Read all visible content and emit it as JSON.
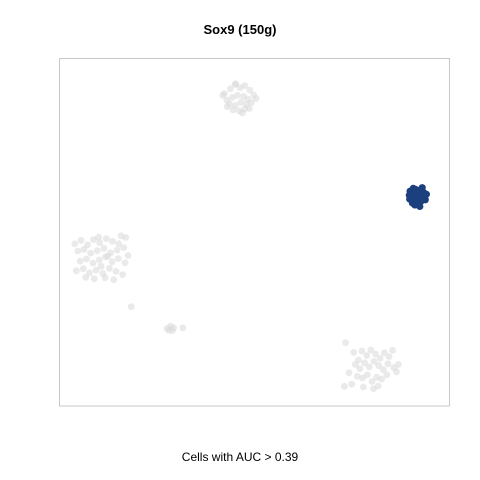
{
  "chart_data": {
    "type": "scatter",
    "title": "Sox9 (150g)",
    "caption": "Cells with AUC > 0.39",
    "xlim": [
      0,
      100
    ],
    "ylim": [
      0,
      100
    ],
    "grid": false,
    "colors": {
      "active": "#1c3f7e",
      "inactive": "#d9d9d9",
      "frame": "#c8c8c8"
    },
    "series": [
      {
        "status": "active",
        "points": [
          [
            90.0,
            61.8
          ],
          [
            91.4,
            62.3
          ],
          [
            92.6,
            62.1
          ],
          [
            93.5,
            61.4
          ],
          [
            89.8,
            60.6
          ],
          [
            91.0,
            60.8
          ],
          [
            92.3,
            60.4
          ],
          [
            93.7,
            60.1
          ],
          [
            90.4,
            59.3
          ],
          [
            91.6,
            59.0
          ],
          [
            92.8,
            58.9
          ],
          [
            93.9,
            59.3
          ],
          [
            91.2,
            57.8
          ],
          [
            92.5,
            57.4
          ],
          [
            90.6,
            58.4
          ],
          [
            92.0,
            61.3
          ],
          [
            90.8,
            62.6
          ],
          [
            93.1,
            62.8
          ],
          [
            94.2,
            60.9
          ],
          [
            89.9,
            59.5
          ]
        ]
      },
      {
        "status": "inactive",
        "points": [
          [
            42.3,
            90.0
          ],
          [
            43.8,
            91.4
          ],
          [
            45.0,
            92.6
          ],
          [
            46.3,
            91.7
          ],
          [
            47.5,
            92.3
          ],
          [
            48.8,
            91.0
          ],
          [
            49.8,
            89.6
          ],
          [
            42.9,
            88.1
          ],
          [
            44.3,
            88.9
          ],
          [
            45.6,
            89.5
          ],
          [
            47.2,
            89.2
          ],
          [
            48.3,
            88.4
          ],
          [
            43.6,
            87.0
          ],
          [
            45.1,
            86.6
          ],
          [
            46.5,
            87.5
          ],
          [
            47.9,
            86.9
          ],
          [
            49.2,
            87.4
          ],
          [
            44.5,
            85.3
          ],
          [
            46.1,
            85.0
          ],
          [
            47.5,
            85.6
          ],
          [
            45.2,
            92.9
          ],
          [
            41.8,
            89.5
          ],
          [
            50.4,
            88.6
          ],
          [
            46.9,
            84.4
          ],
          [
            43.0,
            86.2
          ],
          [
            48.7,
            85.7
          ]
        ]
      },
      {
        "status": "inactive",
        "points": [
          [
            3.8,
            46.6
          ],
          [
            5.4,
            47.6
          ],
          [
            7.1,
            46.3
          ],
          [
            8.6,
            47.8
          ],
          [
            10.2,
            46.9
          ],
          [
            11.9,
            48.1
          ],
          [
            13.5,
            47.3
          ],
          [
            15.1,
            46.6
          ],
          [
            16.9,
            48.4
          ],
          [
            4.6,
            44.5
          ],
          [
            6.2,
            45.0
          ],
          [
            7.9,
            43.9
          ],
          [
            9.6,
            44.6
          ],
          [
            11.3,
            45.3
          ],
          [
            13.0,
            44.0
          ],
          [
            14.7,
            44.8
          ],
          [
            16.4,
            45.5
          ],
          [
            5.2,
            41.6
          ],
          [
            6.8,
            42.2
          ],
          [
            8.5,
            41.0
          ],
          [
            10.1,
            41.9
          ],
          [
            11.7,
            42.8
          ],
          [
            13.4,
            41.4
          ],
          [
            15.0,
            42.3
          ],
          [
            16.7,
            41.1
          ],
          [
            4.2,
            38.8
          ],
          [
            6.0,
            39.4
          ],
          [
            7.6,
            38.2
          ],
          [
            9.3,
            39.0
          ],
          [
            11.0,
            38.0
          ],
          [
            12.7,
            39.5
          ],
          [
            14.4,
            38.6
          ],
          [
            16.1,
            37.7
          ],
          [
            8.8,
            36.5
          ],
          [
            11.6,
            36.8
          ],
          [
            13.8,
            36.2
          ],
          [
            6.6,
            36.9
          ],
          [
            15.7,
            48.9
          ],
          [
            9.9,
            48.5
          ],
          [
            17.5,
            43.2
          ],
          [
            10.6,
            40.1
          ],
          [
            12.3,
            43.0
          ]
        ]
      },
      {
        "status": "inactive",
        "points": [
          [
            18.3,
            28.4
          ]
        ]
      },
      {
        "status": "inactive",
        "points": [
          [
            27.5,
            22.1
          ],
          [
            28.4,
            22.8
          ],
          [
            29.2,
            22.3
          ],
          [
            28.0,
            21.6
          ],
          [
            28.9,
            21.5
          ],
          [
            31.6,
            22.3
          ]
        ]
      },
      {
        "status": "inactive",
        "points": [
          [
            73.4,
            18.0
          ],
          [
            75.5,
            15.2
          ],
          [
            76.7,
            13.0
          ],
          [
            77.6,
            15.6
          ],
          [
            78.9,
            14.3
          ],
          [
            79.9,
            15.9
          ],
          [
            81.1,
            14.7
          ],
          [
            82.3,
            13.5
          ],
          [
            83.4,
            15.1
          ],
          [
            84.6,
            14.0
          ],
          [
            85.5,
            15.8
          ],
          [
            75.9,
            11.7
          ],
          [
            77.1,
            10.5
          ],
          [
            78.3,
            12.2
          ],
          [
            79.5,
            11.0
          ],
          [
            80.7,
            12.6
          ],
          [
            81.9,
            11.4
          ],
          [
            83.1,
            10.2
          ],
          [
            84.3,
            11.9
          ],
          [
            85.8,
            10.8
          ],
          [
            87.0,
            11.7
          ],
          [
            74.3,
            9.3
          ],
          [
            76.4,
            8.3
          ],
          [
            77.8,
            7.8
          ],
          [
            79.0,
            8.7
          ],
          [
            80.2,
            6.8
          ],
          [
            81.4,
            8.0
          ],
          [
            82.7,
            7.5
          ],
          [
            84.0,
            8.7
          ],
          [
            78.0,
            5.2
          ],
          [
            80.6,
            4.7
          ],
          [
            73.1,
            5.4
          ],
          [
            75.0,
            6.0
          ],
          [
            86.5,
            9.6
          ],
          [
            81.8,
            5.5
          ]
        ]
      }
    ]
  }
}
